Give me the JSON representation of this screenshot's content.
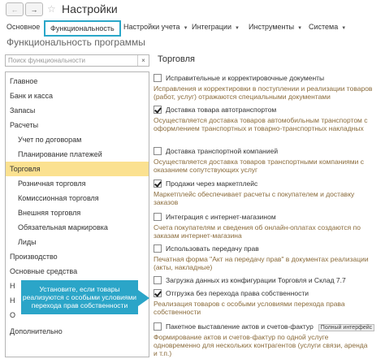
{
  "window": {
    "title": "Настройки"
  },
  "tabs": [
    {
      "label": "Основное",
      "dropdown": false
    },
    {
      "label": "Функциональность",
      "dropdown": false,
      "active": true
    },
    {
      "label": "Настройки учета",
      "dropdown": true
    },
    {
      "label": "Интеграции",
      "dropdown": true
    },
    {
      "label": "Инструменты",
      "dropdown": true
    },
    {
      "label": "Система",
      "dropdown": true
    }
  ],
  "section_title": "Функциональность программы",
  "search": {
    "placeholder": "Поиск функциональности",
    "clear_glyph": "×"
  },
  "sidebar": {
    "items": [
      {
        "label": "Главное",
        "sub": false
      },
      {
        "label": "Банк и касса",
        "sub": false
      },
      {
        "label": "Запасы",
        "sub": false
      },
      {
        "label": "Расчеты",
        "sub": false
      },
      {
        "label": "Учет по договорам",
        "sub": true
      },
      {
        "label": "Планирование платежей",
        "sub": true
      },
      {
        "label": "Торговля",
        "sub": false,
        "selected": true
      },
      {
        "label": "Розничная торговля",
        "sub": true
      },
      {
        "label": "Комиссионная торговля",
        "sub": true
      },
      {
        "label": "Внешняя торговля",
        "sub": true
      },
      {
        "label": "Обязательная маркировка",
        "sub": true
      },
      {
        "label": "Лиды",
        "sub": true
      },
      {
        "label": "Производство",
        "sub": false
      },
      {
        "label": "Основные средства",
        "sub": false
      },
      {
        "label": "Н",
        "sub": false
      },
      {
        "label": "Н",
        "sub": false
      },
      {
        "label": "О",
        "sub": false
      },
      {
        "label": "Дополнительно",
        "sub": false
      }
    ]
  },
  "content": {
    "title": "Торговля",
    "options": [
      {
        "label": "Исправительные и корректировочные документы",
        "checked": false,
        "desc": "Исправления и корректировки в поступлении и реализации товаров (работ, услуг) отражаются специальными документами"
      },
      {
        "label": "Доставка товара автотранспортом",
        "checked": true,
        "desc": "Осуществляется доставка товаров автомобильным транспортом с оформлением транспортных и товарно-транспортных накладных"
      },
      {
        "label": "Доставка транспортной компанией",
        "checked": false,
        "desc": "Осуществляется доставка товаров транспортными компаниями с оказанием сопутствующих услуг"
      },
      {
        "label": "Продажи через маркетплейс",
        "checked": true,
        "desc": "Маркетплейс обеспечивает расчеты с покупателем и доставку заказов"
      },
      {
        "label": "Интеграция с интернет-магазином",
        "checked": false,
        "desc": "Счета покупателям и сведения об онлайн-оплатах создаются по заказам интернет-магазина"
      },
      {
        "label": "Использовать передачу прав",
        "checked": false,
        "desc": "Печатная форма \"Акт на передачу прав\" в документах реализации (акты, накладные)"
      },
      {
        "label": "Загрузка данных из конфигурации Торговля и Склад 7.7",
        "checked": false,
        "desc": ""
      },
      {
        "label": "Отгрузка без перехода права собственности",
        "checked": true,
        "desc": "Реализация товаров с особыми условиями перехода права собственности"
      },
      {
        "label": "Пакетное выставление актов и счетов-фактур",
        "checked": false,
        "badge": "Полный интерфейс",
        "desc": "Формирование актов и счетов-фактур по одной услуге одновременно для нескольких контрагентов (услуги связи, аренда и т.п.)"
      }
    ]
  },
  "callout": {
    "text": "Установите, если товары реализуются с особыми условиями перехода прав собственности"
  }
}
